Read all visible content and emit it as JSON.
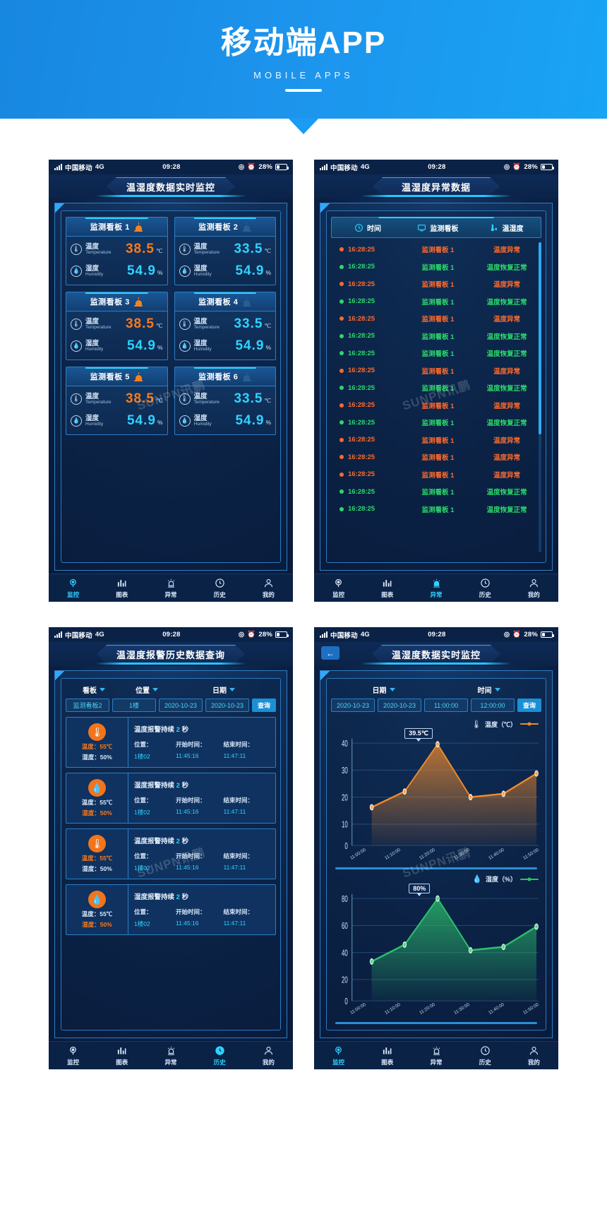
{
  "banner": {
    "title": "移动端APP",
    "subtitle": "MOBILE APPS"
  },
  "status_bar": {
    "carrier": "中国移动",
    "network": "4G",
    "time": "09:28",
    "battery": "28%"
  },
  "nav_tabs": [
    {
      "label": "监控",
      "icon": "monitor-icon"
    },
    {
      "label": "图表",
      "icon": "chart-icon"
    },
    {
      "label": "异常",
      "icon": "alarm-icon"
    },
    {
      "label": "历史",
      "icon": "clock-icon"
    },
    {
      "label": "我的",
      "icon": "user-icon"
    }
  ],
  "colors": {
    "accent_cyan": "#2fd3ff",
    "accent_orange": "#ff7a18",
    "accent_green": "#2bd96a",
    "panel_border": "#2b7fc6",
    "bg_deep": "#0b2247"
  },
  "screen1": {
    "title": "温湿度数据实时监控",
    "active_tab": "监控",
    "watermark": "SUNPN讯鹏",
    "labels": {
      "temp_cn": "温度",
      "temp_en": "Temperature",
      "temp_unit": "℃",
      "hum_cn": "湿度",
      "hum_en": "Humidity",
      "hum_unit": "%"
    },
    "cards": [
      {
        "name": "监测看板 1",
        "alarm": true,
        "temp": "38.5",
        "temp_state": "hot",
        "hum": "54.9"
      },
      {
        "name": "监测看板 2",
        "alarm": false,
        "temp": "33.5",
        "temp_state": "cool",
        "hum": "54.9"
      },
      {
        "name": "监测看板 3",
        "alarm": true,
        "temp": "38.5",
        "temp_state": "hot",
        "hum": "54.9"
      },
      {
        "name": "监测看板 4",
        "alarm": false,
        "temp": "33.5",
        "temp_state": "cool",
        "hum": "54.9"
      },
      {
        "name": "监测看板 5",
        "alarm": true,
        "temp": "38.5",
        "temp_state": "hot",
        "hum": "54.9"
      },
      {
        "name": "监测看板 6",
        "alarm": false,
        "temp": "33.5",
        "temp_state": "cool",
        "hum": "54.9"
      }
    ]
  },
  "screen2": {
    "title": "温湿度异常数据",
    "active_tab": "异常",
    "watermark": "SUNPN讯鹏",
    "columns": [
      {
        "label": "时间",
        "icon": "clock-icon"
      },
      {
        "label": "监测看板",
        "icon": "board-icon"
      },
      {
        "label": "温湿度",
        "icon": "thermo-drop-icon"
      }
    ],
    "rows": [
      {
        "time": "16:28:25",
        "board": "监测看板 1",
        "status": "温度异常",
        "state": "alarm"
      },
      {
        "time": "16:28:25",
        "board": "监测看板 1",
        "status": "温度恢复正常",
        "state": "ok"
      },
      {
        "time": "16:28:25",
        "board": "监测看板 1",
        "status": "温度异常",
        "state": "alarm"
      },
      {
        "time": "16:28:25",
        "board": "监测看板 1",
        "status": "温度恢复正常",
        "state": "ok"
      },
      {
        "time": "16:28:25",
        "board": "监测看板 1",
        "status": "温度异常",
        "state": "alarm"
      },
      {
        "time": "16:28:25",
        "board": "监测看板 1",
        "status": "温度恢复正常",
        "state": "ok"
      },
      {
        "time": "16:28:25",
        "board": "监测看板 1",
        "status": "温度恢复正常",
        "state": "ok"
      },
      {
        "time": "16:28:25",
        "board": "监测看板 1",
        "status": "温度异常",
        "state": "alarm"
      },
      {
        "time": "16:28:25",
        "board": "监测看板 1",
        "status": "温度恢复正常",
        "state": "ok"
      },
      {
        "time": "16:28:25",
        "board": "监测看板 1",
        "status": "温度异常",
        "state": "alarm"
      },
      {
        "time": "16:28:25",
        "board": "监测看板 1",
        "status": "温度恢复正常",
        "state": "ok"
      },
      {
        "time": "16:28:25",
        "board": "监测看板 1",
        "status": "温度异常",
        "state": "alarm"
      },
      {
        "time": "16:28:25",
        "board": "监测看板 1",
        "status": "温度异常",
        "state": "alarm"
      },
      {
        "time": "16:28:25",
        "board": "监测看板 1",
        "status": "温度异常",
        "state": "alarm"
      },
      {
        "time": "16:28:25",
        "board": "监测看板 1",
        "status": "温度恢复正常",
        "state": "ok"
      },
      {
        "time": "16:28:25",
        "board": "监测看板 1",
        "status": "温度恢复正常",
        "state": "ok"
      }
    ]
  },
  "screen3": {
    "title": "温湿度报警历史数据查询",
    "active_tab": "历史",
    "watermark": "SUNPN讯鹏",
    "filter_labels": [
      "看板",
      "位置",
      "日期"
    ],
    "filter_values": [
      "监测看板2",
      "1楼",
      "2020-10-23",
      "2020-10-23"
    ],
    "search_label": "查询",
    "record_field_labels": {
      "position": "位置：",
      "start": "开始时间：",
      "end": "结束时间："
    },
    "records": [
      {
        "icon": "thermometer-icon",
        "headline_pre": "温度报警持续",
        "headline_num": "2",
        "headline_post": "秒",
        "temp_line": "温度：55℃",
        "temp_hot": true,
        "hum_line": "湿度：50%",
        "hum_hot": false,
        "position": "1楼02",
        "start": "11:45:16",
        "end": "11:47:11"
      },
      {
        "icon": "droplet-icon",
        "headline_pre": "湿度报警持续",
        "headline_num": "2",
        "headline_post": "秒",
        "temp_line": "温度：55℃",
        "temp_hot": false,
        "hum_line": "湿度：50%",
        "hum_hot": true,
        "position": "1楼02",
        "start": "11:45:16",
        "end": "11:47:11"
      },
      {
        "icon": "thermometer-icon",
        "headline_pre": "温度报警持续",
        "headline_num": "2",
        "headline_post": "秒",
        "temp_line": "温度：55℃",
        "temp_hot": true,
        "hum_line": "湿度：50%",
        "hum_hot": false,
        "position": "1楼02",
        "start": "11:45:16",
        "end": "11:47:11"
      },
      {
        "icon": "droplet-icon",
        "headline_pre": "湿度报警持续",
        "headline_num": "2",
        "headline_post": "秒",
        "temp_line": "温度：55℃",
        "temp_hot": false,
        "hum_line": "湿度：50%",
        "hum_hot": true,
        "position": "1楼02",
        "start": "11:45:16",
        "end": "11:47:11"
      }
    ]
  },
  "screen4": {
    "title": "温湿度数据实时监控",
    "active_tab": "监控",
    "watermark": "SUNPN讯鹏",
    "back_icon": "back-arrow-icon",
    "filter_labels": [
      "日期",
      "时间"
    ],
    "filter_values": [
      "2020-10-23",
      "2020-10-23",
      "11:00:00",
      "12:00:00"
    ],
    "search_label": "查询"
  },
  "chart_data": [
    {
      "type": "line",
      "title": "温度（℃）",
      "legend": "温度（℃）",
      "legend_icon": "thermometer-icon",
      "color": "#f08a2a",
      "xlabel": "",
      "ylabel": "",
      "ylim": [
        0,
        40
      ],
      "yticks": [
        0,
        10,
        20,
        30,
        40
      ],
      "x": [
        "11:00:00",
        "11:10:00",
        "11:20:00",
        "11:30:00",
        "11:40:00",
        "11:50:00"
      ],
      "values": [
        15,
        21,
        39.5,
        19,
        20,
        28
      ],
      "annotation": {
        "label": "39.5℃",
        "at_index": 2
      },
      "grid": true,
      "legend_position": "top-right"
    },
    {
      "type": "line",
      "title": "湿度（%）",
      "legend": "湿度（%）",
      "legend_icon": "droplet-icon",
      "color": "#2dc26b",
      "xlabel": "",
      "ylabel": "",
      "ylim": [
        0,
        80
      ],
      "yticks": [
        0,
        20,
        40,
        60,
        80
      ],
      "x": [
        "11:00:00",
        "11:10:00",
        "11:20:00",
        "11:30:00",
        "11:40:00",
        "11:50:00"
      ],
      "values": [
        31,
        44,
        80,
        40,
        42,
        58
      ],
      "annotation": {
        "label": "80%",
        "at_index": 2
      },
      "grid": true,
      "legend_position": "top-right"
    }
  ]
}
